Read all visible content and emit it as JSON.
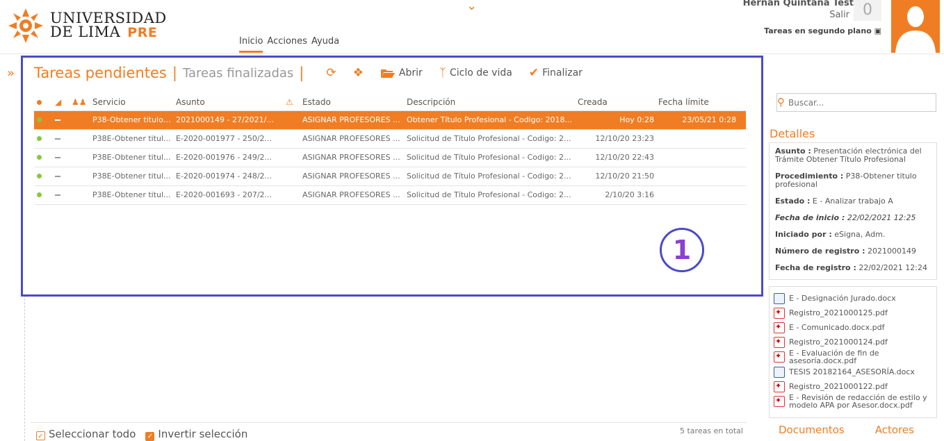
{
  "header": {
    "brand_line1": "UNIVERSIDAD",
    "brand_line2": "DE LIMA",
    "brand_suffix": "PRE",
    "nav": [
      "Inicio",
      "Acciones",
      "Ayuda"
    ],
    "user_name": "Hernan Quintana Test",
    "logout": "Salir",
    "notification_count": "0",
    "background_tasks": "Tareas en segundo plano"
  },
  "toolbar": {
    "tab_pending": "Tareas pendientes",
    "tab_finished": "Tareas finalizadas",
    "separator": "|",
    "open": "Abrir",
    "lifecycle": "Ciclo de vida",
    "finish": "Finalizar"
  },
  "table": {
    "columns": [
      "Servicio",
      "Asunto",
      "Estado",
      "Descripción",
      "Creada",
      "Fecha límite"
    ],
    "rows": [
      {
        "servicio": "P38-Obtener titulo ...",
        "asunto": "2021000149 - 27/2021/...",
        "estado": "ASIGNAR PROFESORES ...",
        "descripcion": "Obtener Título Profesional - Codigo: 2018...",
        "creada": "Hoy 0:28",
        "limite": "23/05/21 0:28",
        "selected": true
      },
      {
        "servicio": "P38E-Obtener titul...",
        "asunto": "E-2020-001977 - 250/2...",
        "estado": "ASIGNAR PROFESORES ...",
        "descripcion": "Solicitud de Título Profesional - Codigo: 2...",
        "creada": "12/10/20 23:23",
        "limite": "",
        "selected": false
      },
      {
        "servicio": "P38E-Obtener titul...",
        "asunto": "E-2020-001976 - 249/2...",
        "estado": "ASIGNAR PROFESORES ...",
        "descripcion": "Solicitud de Título Profesional - Codigo: 2...",
        "creada": "12/10/20 22:43",
        "limite": "",
        "selected": false
      },
      {
        "servicio": "P38E-Obtener titul...",
        "asunto": "E-2020-001974 - 248/2...",
        "estado": "ASIGNAR PROFESORES ...",
        "descripcion": "Solicitud de Título Profesional - Codigo: 2...",
        "creada": "12/10/20 21:50",
        "limite": "",
        "selected": false
      },
      {
        "servicio": "P38E-Obtener titul...",
        "asunto": "E-2020-001693 - 207/2...",
        "estado": "ASIGNAR PROFESORES ...",
        "descripcion": "Solicitud de Título Profesional - Codigo: 2...",
        "creada": "2/10/20 3:16",
        "limite": "",
        "selected": false
      }
    ]
  },
  "annotation_marker": "1",
  "footer": {
    "select_all": "Seleccionar todo",
    "invert": "Invertir selección",
    "total": "5 tareas en total"
  },
  "sidebar": {
    "search_placeholder": "Buscar...",
    "details_title": "Detalles",
    "details": {
      "asunto_label": "Asunto :",
      "asunto_value": "Presentación electrónica del Trámite Obtener Título Profesional",
      "procedimiento_label": "Procedimiento :",
      "procedimiento_value": "P38-Obtener titulo profesional",
      "estado_label": "Estado :",
      "estado_value": "E - Analizar trabajo A",
      "fecha_inicio_label": "Fecha de inicio :",
      "fecha_inicio_value": "22/02/2021 12:25",
      "iniciado_label": "Iniciado por :",
      "iniciado_value": "eSigna, Adm.",
      "numero_label": "Número de registro :",
      "numero_value": "2021000149",
      "fecha_registro_label": "Fecha de registro :",
      "fecha_registro_value": "22/02/2021 12:24"
    },
    "documents": [
      {
        "name": "E - Designación Jurado.docx",
        "type": "word"
      },
      {
        "name": "Registro_2021000125.pdf",
        "type": "pdf"
      },
      {
        "name": "E - Comunicado.docx.pdf",
        "type": "pdf"
      },
      {
        "name": "Registro_2021000124.pdf",
        "type": "pdf"
      },
      {
        "name": "E - Evaluación de fin de asesoría.docx.pdf",
        "type": "pdf"
      },
      {
        "name": "TESIS 20182164_ASESORÍA.docx",
        "type": "word"
      },
      {
        "name": "Registro_2021000122.pdf",
        "type": "pdf"
      },
      {
        "name": "E - Revisión de redacción de estilo y modelo APA por Asesor.docx.pdf",
        "type": "pdf"
      }
    ],
    "tab_documents": "Documentos",
    "tab_actors": "Actores"
  },
  "colors": {
    "accent": "#f07d23",
    "highlight_border": "#4a4ac8",
    "status_dot": "#8ac640"
  }
}
